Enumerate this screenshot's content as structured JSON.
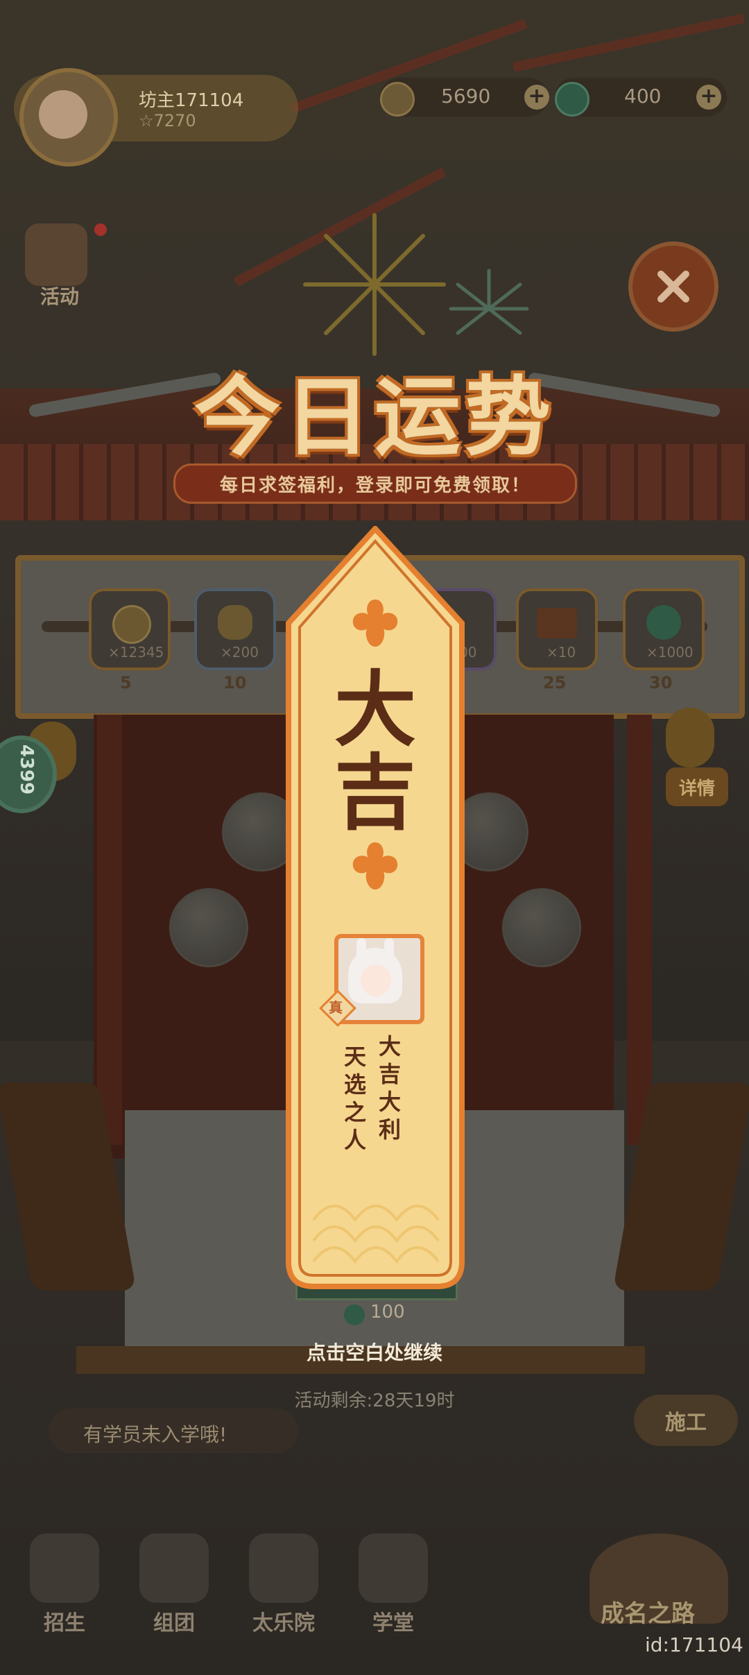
{
  "hud": {
    "player_name": "坊主171104",
    "player_stars": "7270",
    "coins": "5690",
    "jade": "400"
  },
  "side": {
    "activity_label": "活动"
  },
  "popup": {
    "title": "今日运势",
    "subtitle": "每日求签福利，登录即可免费领取！",
    "rewards": [
      {
        "count": "×12345",
        "day": "5",
        "icon": "copper-coin-icon"
      },
      {
        "count": "×200",
        "day": "10",
        "icon": "plum-flower-icon"
      },
      {
        "count": "00",
        "day": "",
        "icon": "book-icon"
      },
      {
        "count": "×10",
        "day": "25",
        "icon": "treasure-chest-icon"
      },
      {
        "count": "×1000",
        "day": "30",
        "icon": "jade-icon"
      }
    ],
    "detail_label": "详情",
    "fortune_top": "大",
    "fortune_bottom": "吉",
    "poem_col1": "大吉大利",
    "poem_col2": "天选之人",
    "rarity_badge": "真",
    "cost": "100",
    "continue_hint": "点击空白处继续",
    "remaining": "活动剩余:28天19时",
    "side_counter": "4399"
  },
  "bottom": {
    "notice": "有学员未入学哦!",
    "build_label": "施工",
    "nav": [
      "招生",
      "组团",
      "太乐院",
      "学堂"
    ],
    "fame_label": "成名之路",
    "uid": "id:171104"
  },
  "colors": {
    "stick_fill": "#f6d790",
    "stick_border": "#e4802f",
    "ink": "#5c2d16",
    "title_stroke": "#c26a24"
  }
}
